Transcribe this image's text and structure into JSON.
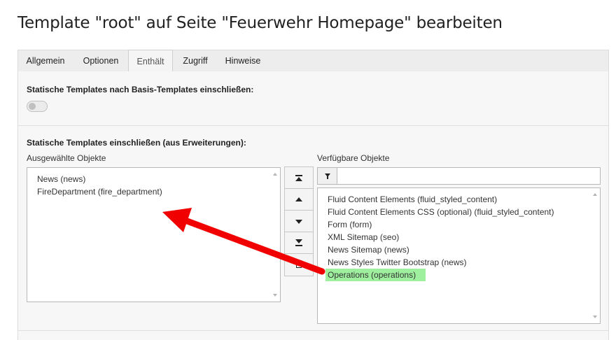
{
  "page": {
    "title": "Template \"root\" auf Seite \"Feuerwehr Homepage\" bearbeiten"
  },
  "tabs": [
    {
      "label": "Allgemein",
      "active": false
    },
    {
      "label": "Optionen",
      "active": false
    },
    {
      "label": "Enthält",
      "active": true
    },
    {
      "label": "Zugriff",
      "active": false
    },
    {
      "label": "Hinweise",
      "active": false
    }
  ],
  "section_basis": {
    "label": "Statische Templates nach Basis-Templates einschließen:",
    "toggle_on": false
  },
  "section_ext": {
    "label": "Statische Templates einschließen (aus Erweiterungen):",
    "selected_label": "Ausgewählte Objekte",
    "available_label": "Verfügbare Objekte",
    "selected_items": [
      "News (news)",
      "FireDepartment (fire_department)"
    ],
    "available_items": [
      "Fluid Content Elements (fluid_styled_content)",
      "Fluid Content Elements CSS (optional) (fluid_styled_content)",
      "Form (form)",
      "XML Sitemap (seo)",
      "News Sitemap (news)",
      "News Styles Twitter Bootstrap (news)",
      "Operations (operations)"
    ],
    "highlighted_item": "Operations (operations)",
    "filter_placeholder": ""
  },
  "annotation": {
    "arrow_color": "#f00000",
    "highlight_color": "#9ef09e"
  },
  "icons": {
    "move_top": "move-to-top-icon",
    "move_up": "move-up-icon",
    "move_down": "move-down-icon",
    "move_bottom": "move-to-bottom-icon",
    "remove": "trash-icon",
    "filter": "filter-icon"
  }
}
